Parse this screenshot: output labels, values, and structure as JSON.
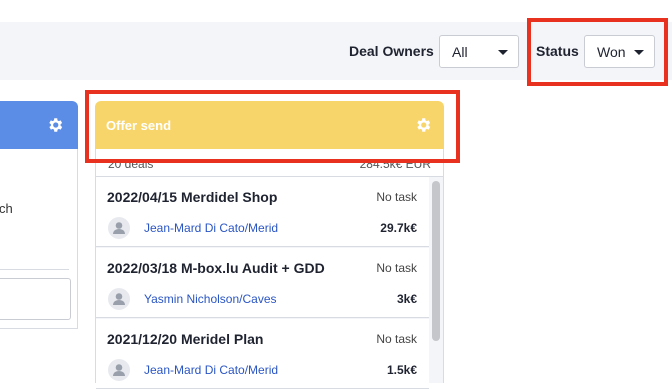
{
  "filters": {
    "deal_owners_label": "Deal Owners",
    "deal_owners_value": "All",
    "status_label": "Status",
    "status_value": "Won"
  },
  "left_column": {
    "partial_text": "ch"
  },
  "column": {
    "title": "Offer send",
    "deal_count": "20 deals",
    "total": "284.5k€ EUR"
  },
  "deals": [
    {
      "title": "2022/04/15 Merdidel Shop",
      "task": "No task",
      "owner": "Jean-Mard Di Cato/Merid",
      "amount": "29.7k€"
    },
    {
      "title": "2022/03/18 M-box.lu Audit + GDD",
      "task": "No task",
      "owner": "Yasmin Nicholson/Caves",
      "amount": "3k€"
    },
    {
      "title": "2021/12/20 Meridel Plan",
      "task": "No task",
      "owner": "Jean-Mard Di Cato/Merid",
      "amount": "1.5k€"
    }
  ],
  "colors": {
    "offer_header": "#f8d56a",
    "left_header": "#5b8de6",
    "highlight": "#e8311f",
    "owner_link": "#2a55c4"
  }
}
